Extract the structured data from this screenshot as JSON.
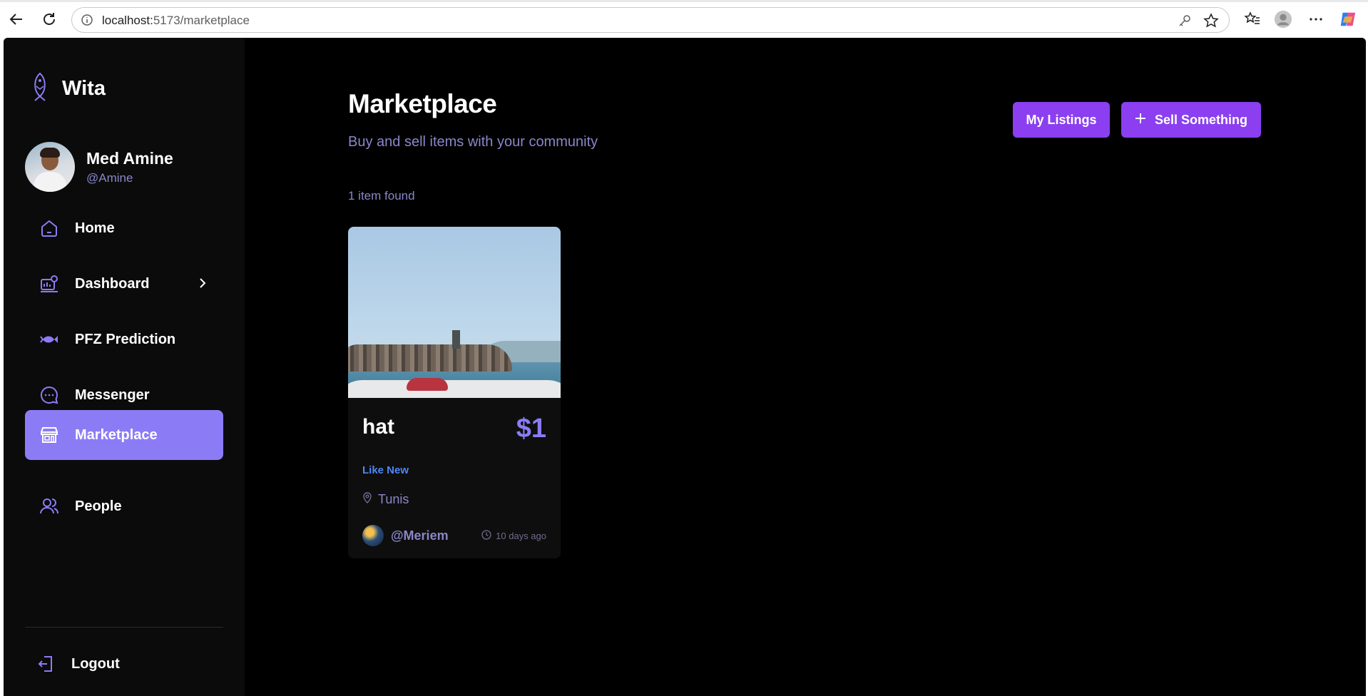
{
  "browser": {
    "url_host": "localhost:",
    "url_path": "5173/marketplace",
    "icons": [
      "back-icon",
      "reload-icon",
      "site-info-icon",
      "key-icon",
      "star-icon",
      "favorites-icon",
      "profile-icon",
      "more-icon",
      "copilot-icon"
    ]
  },
  "sidebar": {
    "brand": "Wita",
    "user": {
      "name": "Med Amine",
      "handle": "@Amine"
    },
    "items": [
      {
        "label": "Home",
        "icon": "home-icon",
        "active": false
      },
      {
        "label": "Dashboard",
        "icon": "dashboard-icon",
        "active": false,
        "has_submenu": true
      },
      {
        "label": "PFZ Prediction",
        "icon": "fish-icon",
        "active": false
      },
      {
        "label": "Messenger",
        "icon": "chat-icon",
        "active": false
      },
      {
        "label": "Marketplace",
        "icon": "store-icon",
        "active": true
      },
      {
        "label": "People",
        "icon": "people-icon",
        "active": false
      }
    ],
    "logout_label": "Logout"
  },
  "main": {
    "title": "Marketplace",
    "subtitle": "Buy and sell items with your community",
    "my_listings_label": "My Listings",
    "sell_label": "Sell Something",
    "result_count": "1 item found",
    "listings": [
      {
        "title": "hat",
        "price": "$1",
        "condition": "Like New",
        "location": "Tunis",
        "seller": "@Meriem",
        "posted": "10 days ago"
      }
    ]
  },
  "colors": {
    "accent": "#8b7cf6",
    "button": "#8b3ff0",
    "muted_text": "#8a86c9",
    "condition": "#4f86f7"
  }
}
